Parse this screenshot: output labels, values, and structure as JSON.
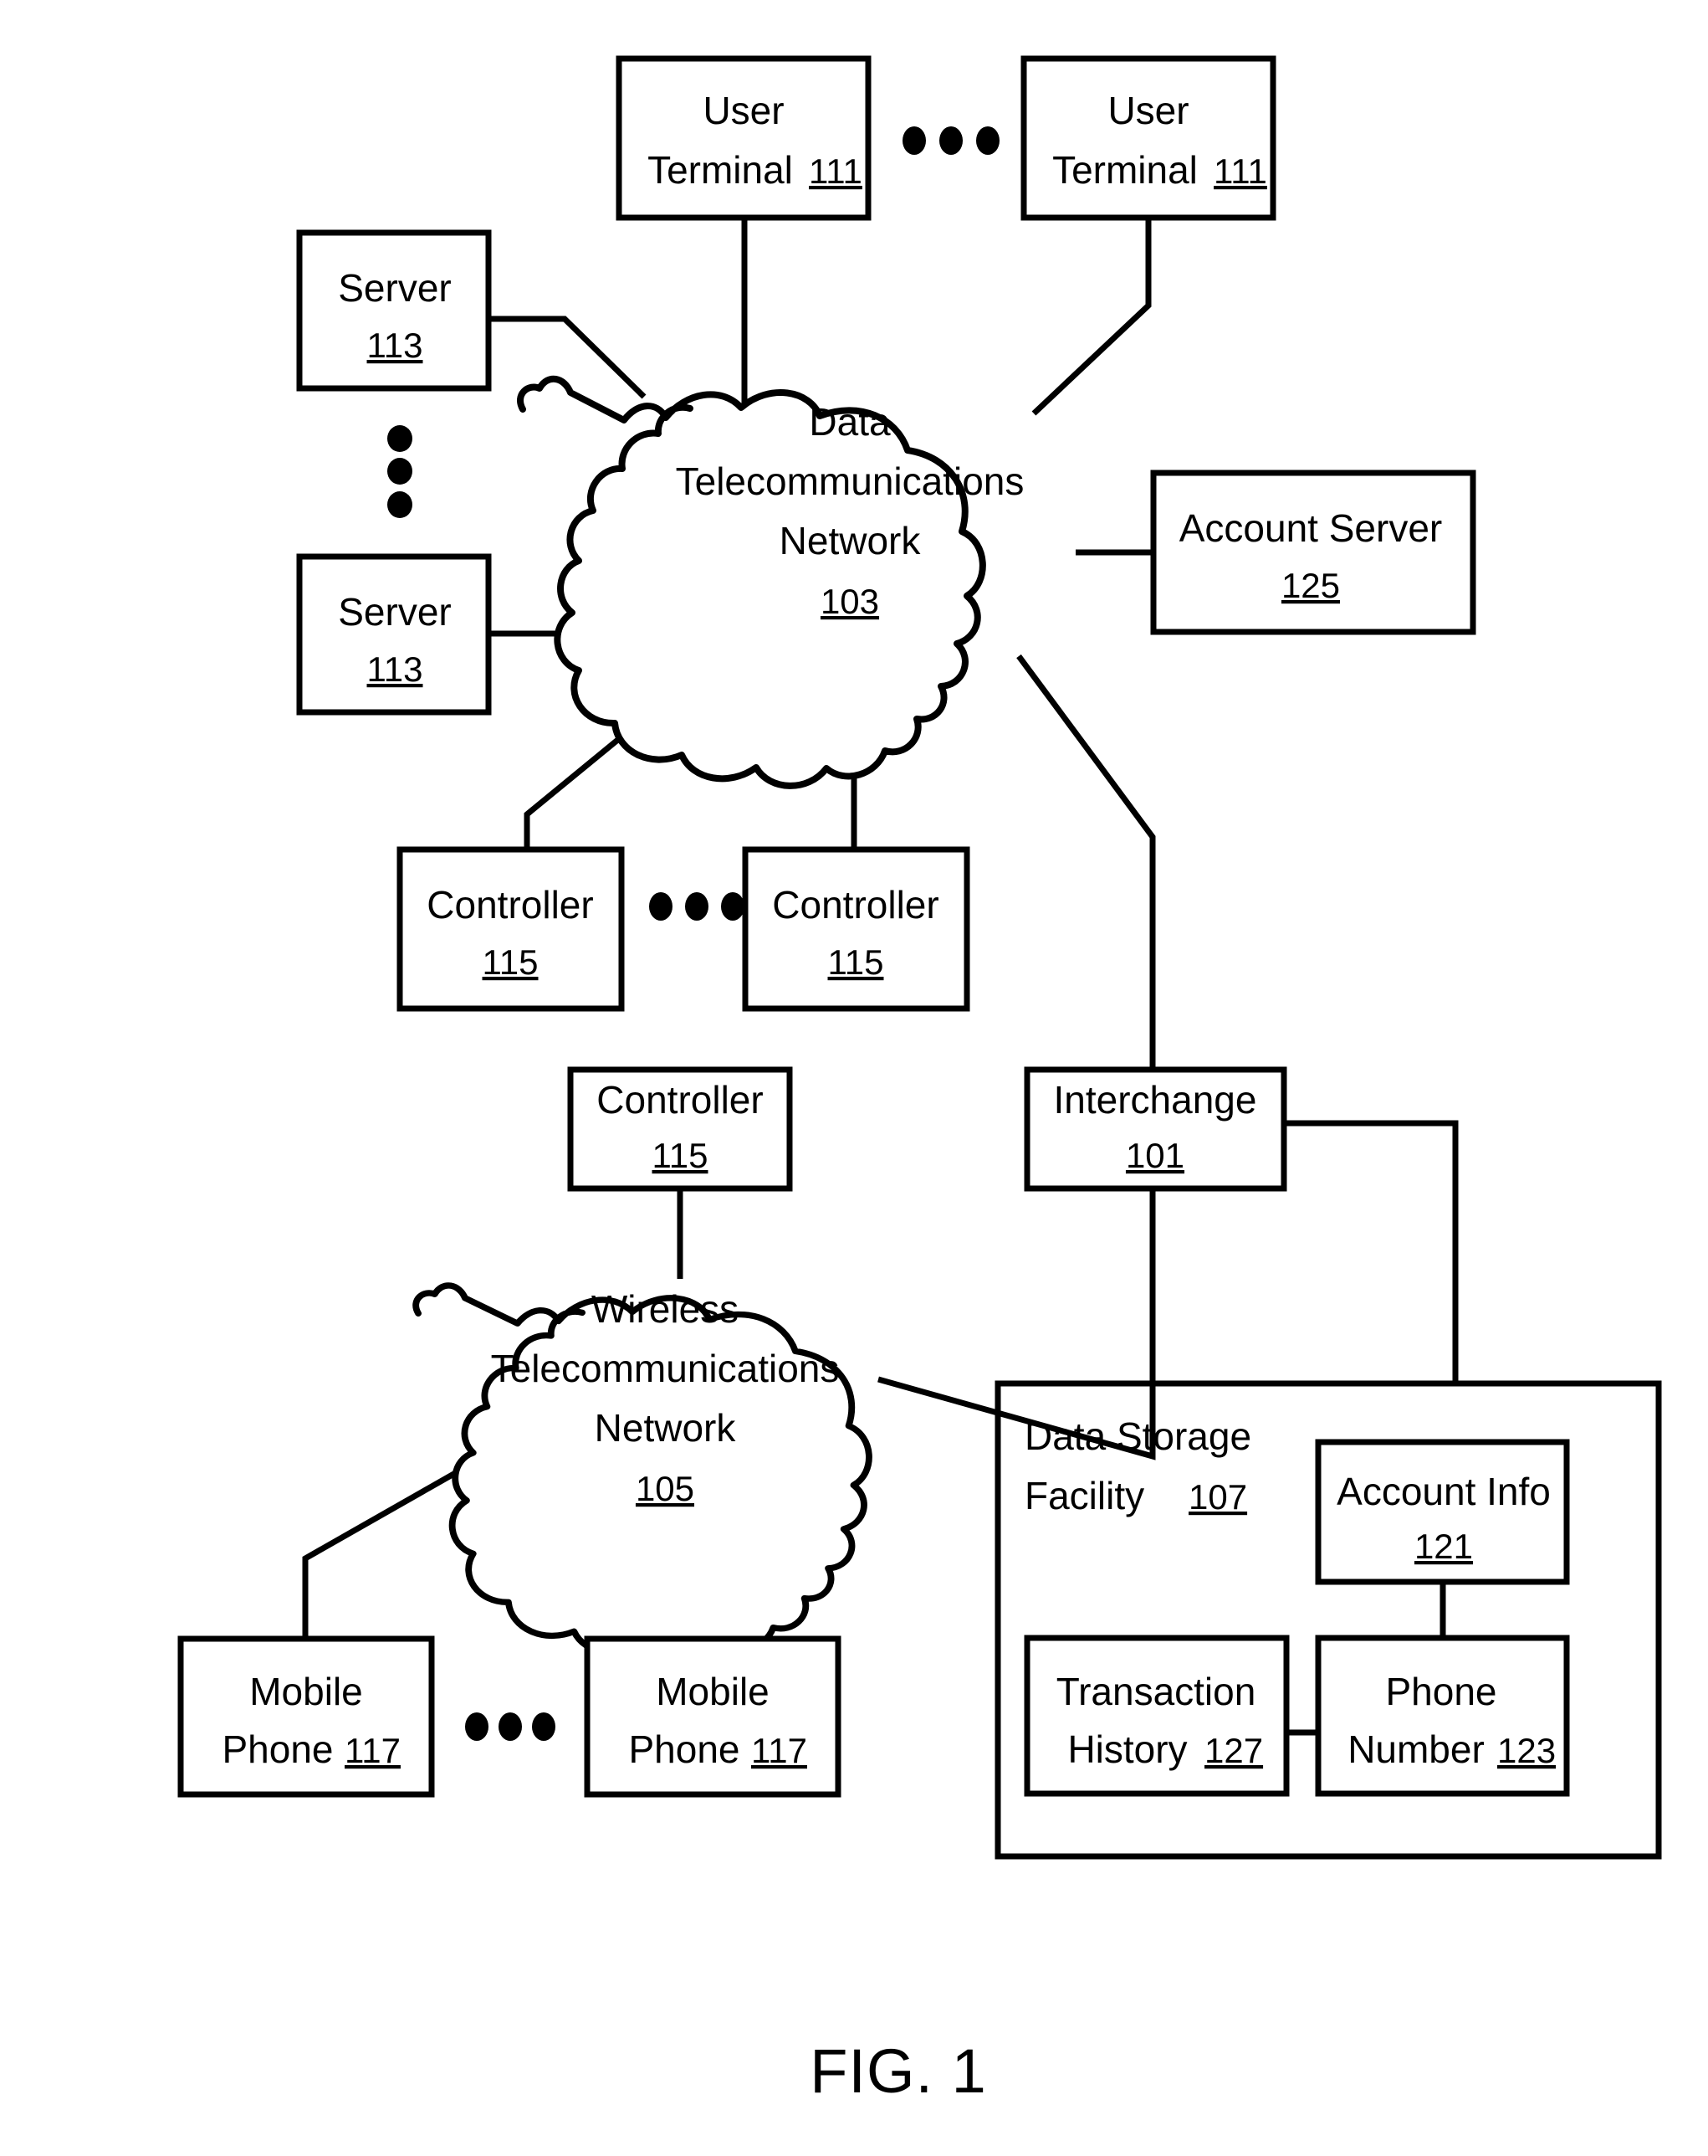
{
  "figure": {
    "caption": "FIG. 1",
    "ellipsis_symbol": "•••"
  },
  "nodes": {
    "user_terminal_left": {
      "line1": "User",
      "line2": "Terminal",
      "ref": "111"
    },
    "user_terminal_right": {
      "line1": "User",
      "line2": "Terminal",
      "ref": "111"
    },
    "server_top": {
      "line1": "Server",
      "ref": "113"
    },
    "server_bottom": {
      "line1": "Server",
      "ref": "113"
    },
    "data_network": {
      "line1": "Data",
      "line2": "Telecommunications",
      "line3": "Network",
      "ref": "103"
    },
    "account_server": {
      "line1": "Account Server",
      "ref": "125"
    },
    "controller_left": {
      "line1": "Controller",
      "ref": "115"
    },
    "controller_right": {
      "line1": "Controller",
      "ref": "115"
    },
    "controller_wireless": {
      "line1": "Controller",
      "ref": "115"
    },
    "interchange": {
      "line1": "Interchange",
      "ref": "101"
    },
    "wireless_network": {
      "line1": "Wireless",
      "line2": "Telecommunications",
      "line3": "Network",
      "ref": "105"
    },
    "mobile_phone_left": {
      "line1": "Mobile",
      "line2": "Phone",
      "ref": "117"
    },
    "mobile_phone_right": {
      "line1": "Mobile",
      "line2": "Phone",
      "ref": "117"
    },
    "data_storage_facility": {
      "line1": "Data Storage",
      "line2": "Facility",
      "ref": "107"
    },
    "account_info": {
      "line1": "Account Info",
      "ref": "121"
    },
    "transaction_history": {
      "line1": "Transaction",
      "line2": "History",
      "ref": "127"
    },
    "phone_number": {
      "line1": "Phone",
      "line2": "Number",
      "ref": "123"
    }
  },
  "ellipses": {
    "user_terminals": "•••",
    "servers_vertical": "•••",
    "controllers": "•••",
    "mobile_phones": "•••"
  },
  "colors": {
    "stroke": "#000000",
    "fill": "#ffffff",
    "text": "#000000"
  }
}
